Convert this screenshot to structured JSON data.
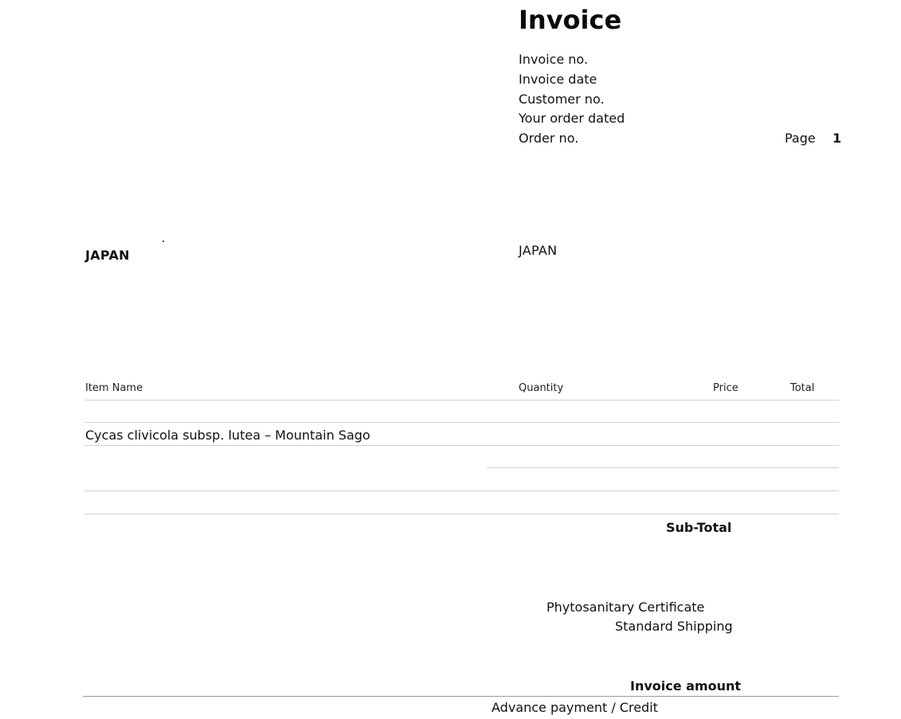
{
  "header": {
    "title": "Invoice",
    "meta_labels": [
      "Invoice no.",
      "Invoice date",
      "Customer no.",
      "Your order dated",
      "Order no."
    ],
    "page_label": "Page",
    "page_number": "1"
  },
  "addresses": {
    "billing_country": "JAPAN",
    "shipping_country": "JAPAN"
  },
  "table": {
    "columns": {
      "item": "Item Name",
      "quantity": "Quantity",
      "price": "Price",
      "total": "Total"
    },
    "rows": [
      {
        "item": "Cycas clivicola subsp. lutea – Mountain Sago"
      }
    ]
  },
  "totals": {
    "subtotal_label": "Sub-Total",
    "fees": [
      "Phytosanitary Certificate",
      "Standard Shipping"
    ],
    "invoice_amount_label": "Invoice amount",
    "advance_payment_label": "Advance payment / Credit"
  }
}
